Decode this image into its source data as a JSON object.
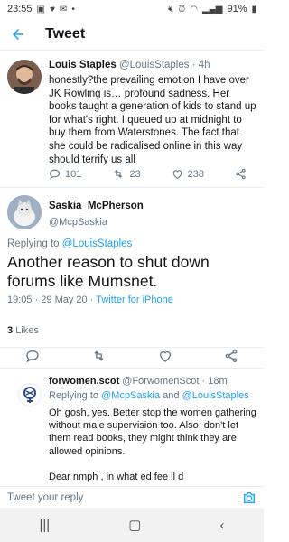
{
  "statusbar": {
    "time": "23:55",
    "battery": "91%"
  },
  "appbar": {
    "title": "Tweet"
  },
  "tweet1": {
    "name": "Louis Staples",
    "handle": "@LouisStaples",
    "sep": "·",
    "age": "4h",
    "text": "honestly?the prevailing emotion I have over JK Rowling is… profound sadness. Her books taught a generation of kids to stand up for what's right. I queued up at midnight to buy them from Waterstones. The fact that she could be radicalised online in this way should terrify us all",
    "replies": "101",
    "retweets": "23",
    "likes": "238"
  },
  "tweet2": {
    "name": "Saskia_McPherson",
    "handle": "@McpSaskia",
    "replying_prefix": "Replying to",
    "replying_to": "@LouisStaples",
    "text": "Another reason to shut down forums like Mumsnet.",
    "timestamp": "19:05 · 29 May 20",
    "meta_sep": " · ",
    "source": "Twitter for iPhone",
    "likes_count": "3",
    "likes_label": "Likes"
  },
  "tweet3": {
    "name": "forwomen.scot",
    "handle": "@ForwomenScot",
    "sep": "·",
    "age": "18m",
    "replying_prefix": "Replying to",
    "replying_to_1": "@McpSaskia",
    "and": "and",
    "replying_to_2": "@LouisStaples",
    "text": "Oh gosh, yes. Better stop the women gathering without male supervision too. Also, don't let them read books, they might think they are allowed opinions.",
    "partial": "Dear nmph   , in what        ed  fee  ll        d"
  },
  "composer": {
    "placeholder": "Tweet your reply"
  },
  "colors": {
    "accent": "#1da1f2",
    "muted": "#657786",
    "text": "#14171a",
    "divider": "#e6ecf0"
  }
}
